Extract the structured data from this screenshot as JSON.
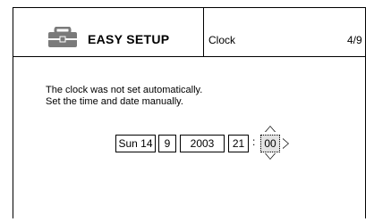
{
  "header": {
    "title": "EASY SETUP",
    "step_name": "Clock",
    "step_count": "4/9",
    "icon": "toolbox-icon"
  },
  "message": {
    "line1": "The clock was not set automatically.",
    "line2": "Set the time and date manually."
  },
  "clock": {
    "weekday_day": "Sun 14",
    "month": "9",
    "year": "2003",
    "hour": "21",
    "separator": ":",
    "minute": "00"
  }
}
